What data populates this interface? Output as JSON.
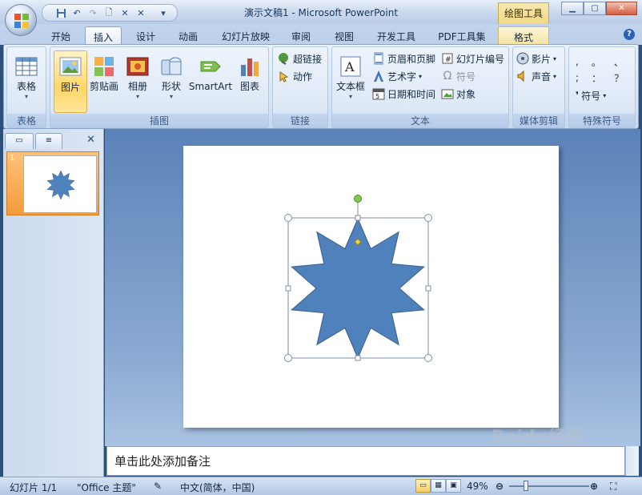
{
  "window": {
    "title": "演示文稿1 - Microsoft PowerPoint",
    "context_tab_title": "绘图工具"
  },
  "qat": {
    "icons": [
      "save-icon",
      "undo-icon",
      "redo-icon",
      "print-preview-icon",
      "delete-icon",
      "customize-icon"
    ]
  },
  "tabs": [
    {
      "label": "开始"
    },
    {
      "label": "插入"
    },
    {
      "label": "设计"
    },
    {
      "label": "动画"
    },
    {
      "label": "幻灯片放映"
    },
    {
      "label": "审阅"
    },
    {
      "label": "视图"
    },
    {
      "label": "开发工具"
    },
    {
      "label": "PDF工具集"
    },
    {
      "label": "格式"
    }
  ],
  "active_tab": "插入",
  "ribbon": {
    "table_group": {
      "label": "表格",
      "table": "表格"
    },
    "illustrations_group": {
      "label": "插图",
      "picture": "图片",
      "clipart": "剪贴画",
      "album": "相册",
      "shapes": "形状",
      "smartart": "SmartArt",
      "chart": "图表"
    },
    "links_group": {
      "label": "链接",
      "hyperlink": "超链接",
      "action": "动作"
    },
    "text_group": {
      "label": "文本",
      "textbox": "文本框",
      "header_footer": "页眉和页脚",
      "wordart": "艺术字",
      "datetime": "日期和时间",
      "slide_number": "幻灯片编号",
      "symbol": "符号",
      "object": "对象"
    },
    "media_group": {
      "label": "媒体剪辑",
      "movie": "影片",
      "sound": "声音"
    },
    "special_group": {
      "label": "特殊符号",
      "symbol": "符号",
      "chars": [
        ",",
        "。",
        "、",
        ";",
        "：",
        "？"
      ]
    }
  },
  "slides_pane": {
    "slide_number": "1"
  },
  "notes": {
    "placeholder": "单击此处添加备注"
  },
  "status": {
    "slide": "幻灯片 1/1",
    "theme": "\"Office 主题\"",
    "language": "中文(简体，中国)",
    "zoom": "49%"
  },
  "watermark": {
    "text": "Baidu经验"
  },
  "colors": {
    "shape_fill": "#4f81bd",
    "shape_stroke": "#385d8a",
    "handle_green": "#84c94a",
    "handle_yellow": "#f3d24a"
  }
}
